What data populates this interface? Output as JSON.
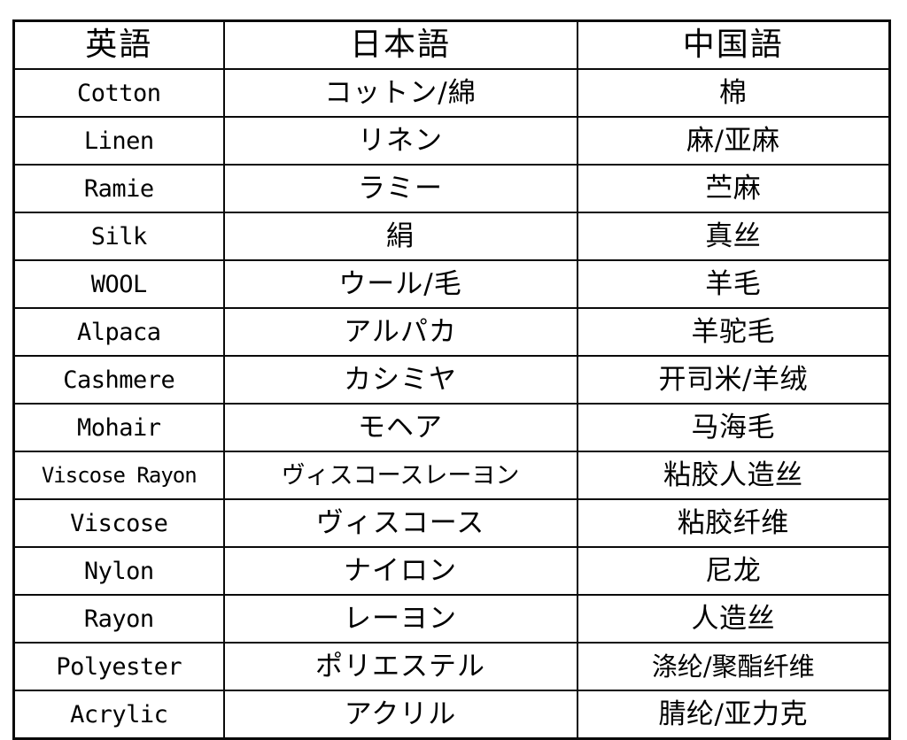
{
  "document": {
    "kind": "scanned-table",
    "ink_color": "#0a0a0a",
    "paper_color": "#ffffff"
  },
  "table": {
    "columns": [
      {
        "key": "english",
        "label": "英語"
      },
      {
        "key": "japanese",
        "label": "日本語"
      },
      {
        "key": "chinese",
        "label": "中国語"
      }
    ],
    "rows": [
      {
        "english": "Cotton",
        "japanese": "コットン/綿",
        "chinese": "棉"
      },
      {
        "english": "Linen",
        "japanese": "リネン",
        "chinese": "麻/亚麻"
      },
      {
        "english": "Ramie",
        "japanese": "ラミー",
        "chinese": "苎麻"
      },
      {
        "english": "Silk",
        "japanese": "絹",
        "chinese": "真丝"
      },
      {
        "english": "WOOL",
        "japanese": "ウール/毛",
        "chinese": "羊毛"
      },
      {
        "english": "Alpaca",
        "japanese": "アルパカ",
        "chinese": "羊驼毛"
      },
      {
        "english": "Cashmere",
        "japanese": "カシミヤ",
        "chinese": "开司米/羊绒"
      },
      {
        "english": "Mohair",
        "japanese": "モヘア",
        "chinese": "马海毛"
      },
      {
        "english": "Viscose Rayon",
        "japanese": "ヴィスコースレーヨン",
        "chinese": "粘胶人造丝"
      },
      {
        "english": "Viscose",
        "japanese": "ヴィスコース",
        "chinese": "粘胶纤维"
      },
      {
        "english": "Nylon",
        "japanese": "ナイロン",
        "chinese": "尼龙"
      },
      {
        "english": "Rayon",
        "japanese": "レーヨン",
        "chinese": "人造丝"
      },
      {
        "english": "Polyester",
        "japanese": "ポリエステル",
        "chinese": "涤纶/聚酯纤维"
      },
      {
        "english": "Acrylic",
        "japanese": "アクリル",
        "chinese": "腈纶/亚力克"
      }
    ]
  }
}
